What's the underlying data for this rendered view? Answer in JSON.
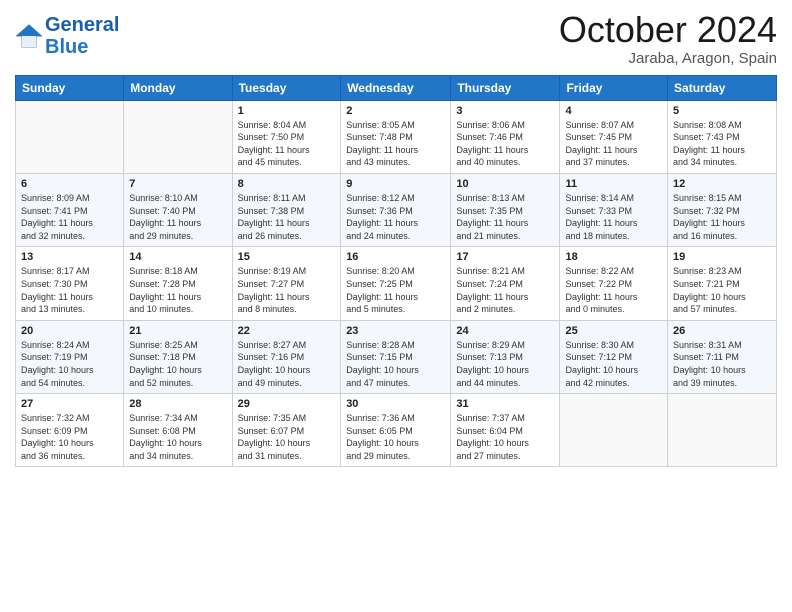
{
  "header": {
    "logo_line1": "General",
    "logo_line2": "Blue",
    "month_title": "October 2024",
    "location": "Jaraba, Aragon, Spain"
  },
  "weekdays": [
    "Sunday",
    "Monday",
    "Tuesday",
    "Wednesday",
    "Thursday",
    "Friday",
    "Saturday"
  ],
  "weeks": [
    [
      {
        "day": "",
        "info": ""
      },
      {
        "day": "",
        "info": ""
      },
      {
        "day": "1",
        "info": "Sunrise: 8:04 AM\nSunset: 7:50 PM\nDaylight: 11 hours\nand 45 minutes."
      },
      {
        "day": "2",
        "info": "Sunrise: 8:05 AM\nSunset: 7:48 PM\nDaylight: 11 hours\nand 43 minutes."
      },
      {
        "day": "3",
        "info": "Sunrise: 8:06 AM\nSunset: 7:46 PM\nDaylight: 11 hours\nand 40 minutes."
      },
      {
        "day": "4",
        "info": "Sunrise: 8:07 AM\nSunset: 7:45 PM\nDaylight: 11 hours\nand 37 minutes."
      },
      {
        "day": "5",
        "info": "Sunrise: 8:08 AM\nSunset: 7:43 PM\nDaylight: 11 hours\nand 34 minutes."
      }
    ],
    [
      {
        "day": "6",
        "info": "Sunrise: 8:09 AM\nSunset: 7:41 PM\nDaylight: 11 hours\nand 32 minutes."
      },
      {
        "day": "7",
        "info": "Sunrise: 8:10 AM\nSunset: 7:40 PM\nDaylight: 11 hours\nand 29 minutes."
      },
      {
        "day": "8",
        "info": "Sunrise: 8:11 AM\nSunset: 7:38 PM\nDaylight: 11 hours\nand 26 minutes."
      },
      {
        "day": "9",
        "info": "Sunrise: 8:12 AM\nSunset: 7:36 PM\nDaylight: 11 hours\nand 24 minutes."
      },
      {
        "day": "10",
        "info": "Sunrise: 8:13 AM\nSunset: 7:35 PM\nDaylight: 11 hours\nand 21 minutes."
      },
      {
        "day": "11",
        "info": "Sunrise: 8:14 AM\nSunset: 7:33 PM\nDaylight: 11 hours\nand 18 minutes."
      },
      {
        "day": "12",
        "info": "Sunrise: 8:15 AM\nSunset: 7:32 PM\nDaylight: 11 hours\nand 16 minutes."
      }
    ],
    [
      {
        "day": "13",
        "info": "Sunrise: 8:17 AM\nSunset: 7:30 PM\nDaylight: 11 hours\nand 13 minutes."
      },
      {
        "day": "14",
        "info": "Sunrise: 8:18 AM\nSunset: 7:28 PM\nDaylight: 11 hours\nand 10 minutes."
      },
      {
        "day": "15",
        "info": "Sunrise: 8:19 AM\nSunset: 7:27 PM\nDaylight: 11 hours\nand 8 minutes."
      },
      {
        "day": "16",
        "info": "Sunrise: 8:20 AM\nSunset: 7:25 PM\nDaylight: 11 hours\nand 5 minutes."
      },
      {
        "day": "17",
        "info": "Sunrise: 8:21 AM\nSunset: 7:24 PM\nDaylight: 11 hours\nand 2 minutes."
      },
      {
        "day": "18",
        "info": "Sunrise: 8:22 AM\nSunset: 7:22 PM\nDaylight: 11 hours\nand 0 minutes."
      },
      {
        "day": "19",
        "info": "Sunrise: 8:23 AM\nSunset: 7:21 PM\nDaylight: 10 hours\nand 57 minutes."
      }
    ],
    [
      {
        "day": "20",
        "info": "Sunrise: 8:24 AM\nSunset: 7:19 PM\nDaylight: 10 hours\nand 54 minutes."
      },
      {
        "day": "21",
        "info": "Sunrise: 8:25 AM\nSunset: 7:18 PM\nDaylight: 10 hours\nand 52 minutes."
      },
      {
        "day": "22",
        "info": "Sunrise: 8:27 AM\nSunset: 7:16 PM\nDaylight: 10 hours\nand 49 minutes."
      },
      {
        "day": "23",
        "info": "Sunrise: 8:28 AM\nSunset: 7:15 PM\nDaylight: 10 hours\nand 47 minutes."
      },
      {
        "day": "24",
        "info": "Sunrise: 8:29 AM\nSunset: 7:13 PM\nDaylight: 10 hours\nand 44 minutes."
      },
      {
        "day": "25",
        "info": "Sunrise: 8:30 AM\nSunset: 7:12 PM\nDaylight: 10 hours\nand 42 minutes."
      },
      {
        "day": "26",
        "info": "Sunrise: 8:31 AM\nSunset: 7:11 PM\nDaylight: 10 hours\nand 39 minutes."
      }
    ],
    [
      {
        "day": "27",
        "info": "Sunrise: 7:32 AM\nSunset: 6:09 PM\nDaylight: 10 hours\nand 36 minutes."
      },
      {
        "day": "28",
        "info": "Sunrise: 7:34 AM\nSunset: 6:08 PM\nDaylight: 10 hours\nand 34 minutes."
      },
      {
        "day": "29",
        "info": "Sunrise: 7:35 AM\nSunset: 6:07 PM\nDaylight: 10 hours\nand 31 minutes."
      },
      {
        "day": "30",
        "info": "Sunrise: 7:36 AM\nSunset: 6:05 PM\nDaylight: 10 hours\nand 29 minutes."
      },
      {
        "day": "31",
        "info": "Sunrise: 7:37 AM\nSunset: 6:04 PM\nDaylight: 10 hours\nand 27 minutes."
      },
      {
        "day": "",
        "info": ""
      },
      {
        "day": "",
        "info": ""
      }
    ]
  ]
}
